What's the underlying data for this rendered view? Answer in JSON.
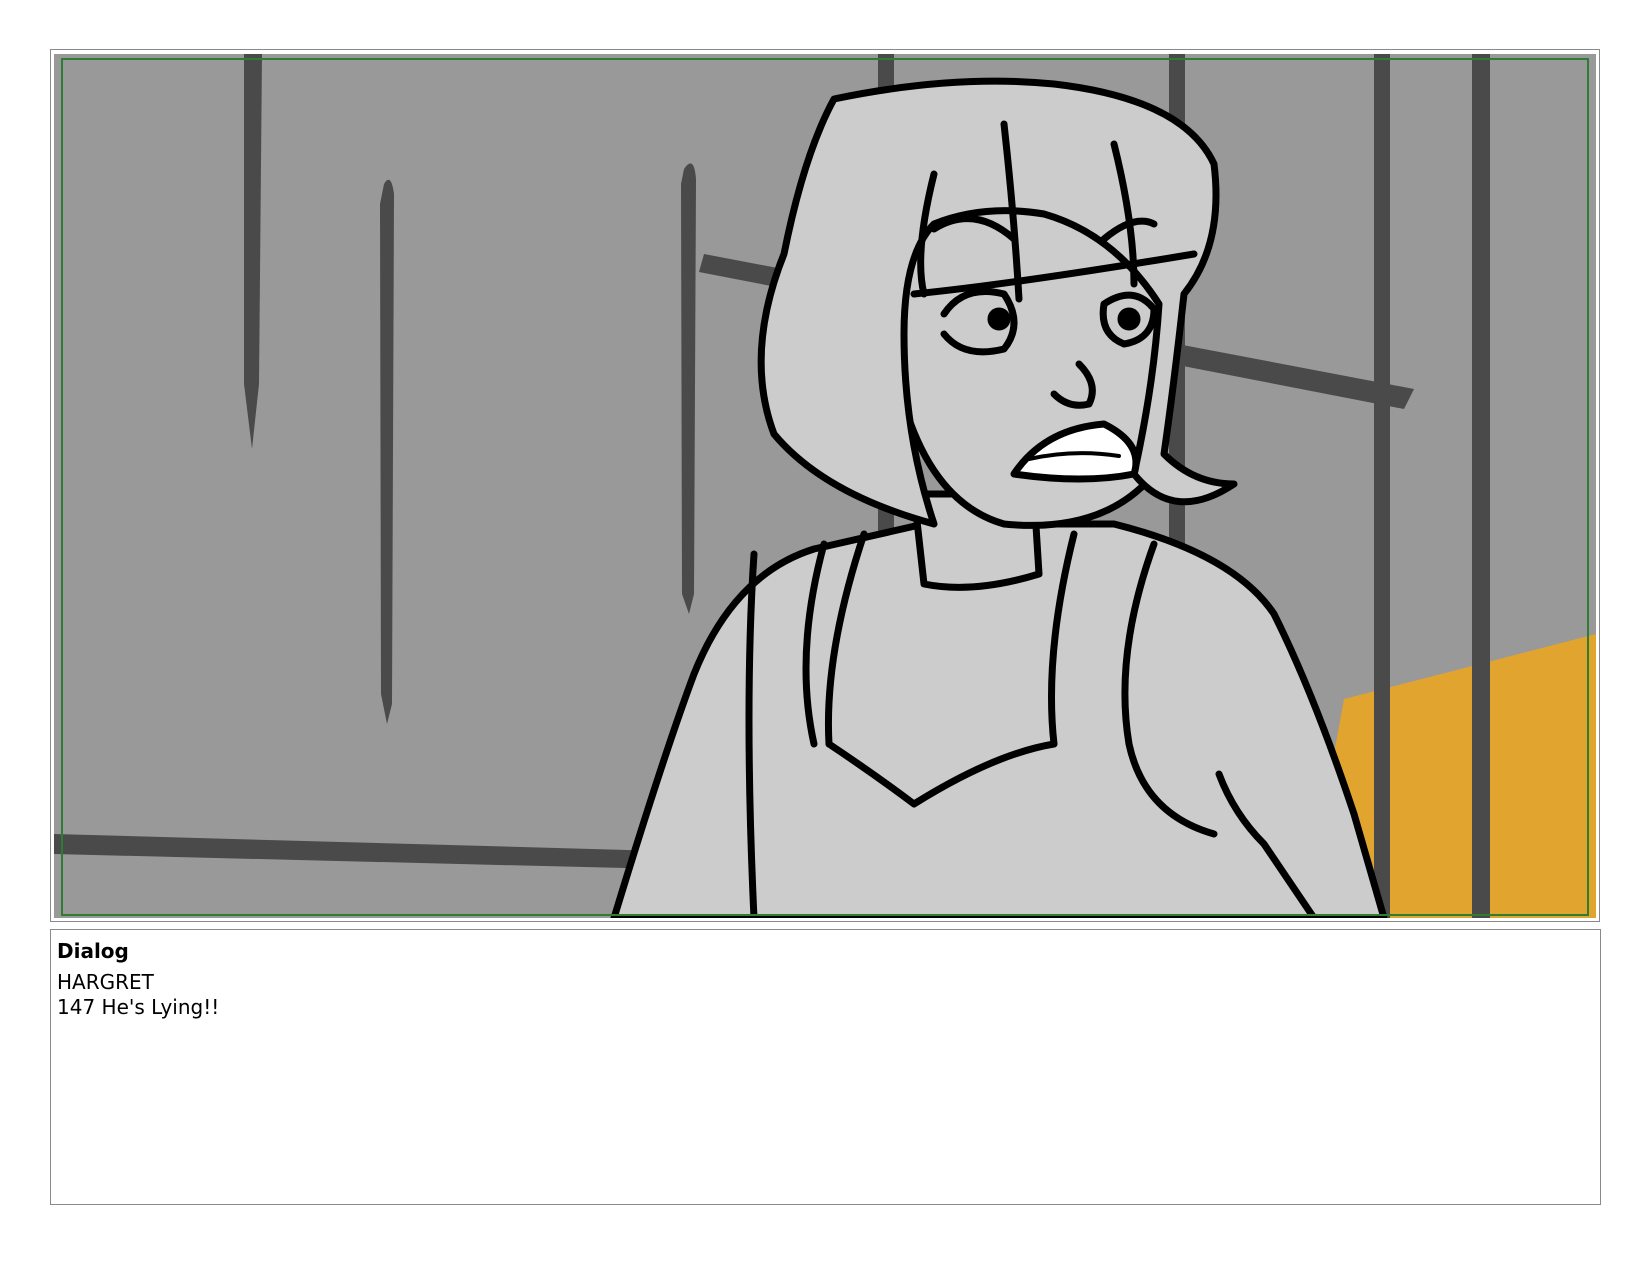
{
  "panel": {
    "background_color": "#999999",
    "bar_color": "#4a4a4a",
    "figure_fill": "#cccccc",
    "ink_color": "#000000",
    "accent_color": "#e0a42f",
    "safe_area_color": "#2e7d32",
    "subject": "storyboard-sketch-angry-woman"
  },
  "dialog": {
    "heading": "Dialog",
    "speaker": "HARGRET",
    "line": "147 He's Lying!!"
  }
}
